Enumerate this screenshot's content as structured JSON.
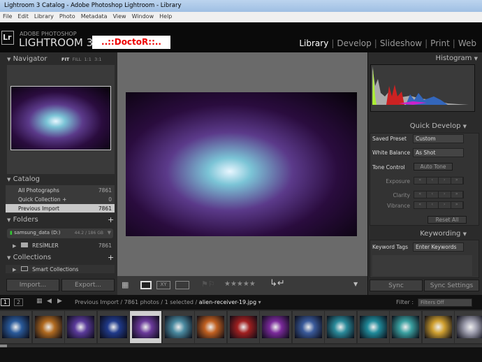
{
  "window": {
    "title": "Lightroom 3 Catalog - Adobe Photoshop Lightroom - Library"
  },
  "menu": [
    "File",
    "Edit",
    "Library",
    "Photo",
    "Metadata",
    "View",
    "Window",
    "Help"
  ],
  "brand": {
    "logo": "Lr",
    "line1": "ADOBE PHOTOSHOP",
    "line2": "LIGHTROOM 3",
    "badge": "..::DoctoR::.."
  },
  "modules": [
    "Library",
    "Develop",
    "Slideshow",
    "Print",
    "Web"
  ],
  "navigator": {
    "title": "Navigator",
    "zoom": [
      "FIT",
      "FILL",
      "1:1",
      "3:1"
    ]
  },
  "catalog": {
    "title": "Catalog",
    "items": [
      {
        "label": "All Photographs",
        "count": "7861"
      },
      {
        "label": "Quick Collection +",
        "count": "0"
      },
      {
        "label": "Previous Import",
        "count": "7861"
      }
    ]
  },
  "folders": {
    "title": "Folders",
    "volume": "samsung_data (D:)",
    "space": "44.2 / 186 GB",
    "folder": "RESİMLER",
    "count": "7861"
  },
  "collections": {
    "title": "Collections",
    "item": "Smart Collections"
  },
  "left_buttons": {
    "import": "Import...",
    "export": "Export..."
  },
  "histogram": {
    "title": "Histogram"
  },
  "quick_develop": {
    "title": "Quick Develop",
    "saved_preset_label": "Saved Preset",
    "saved_preset": "Custom",
    "wb_label": "White Balance",
    "wb": "As Shot",
    "tone_label": "Tone Control",
    "auto_tone": "Auto Tone",
    "exposure": "Exposure",
    "clarity": "Clarity",
    "vibrance": "Vibrance",
    "reset": "Reset All"
  },
  "keywording": {
    "title": "Keywording",
    "tags_label": "Keyword Tags",
    "tags_value": "Enter Keywords"
  },
  "right_buttons": {
    "sync": "Sync",
    "sync_settings": "Sync Settings"
  },
  "toolbar": {
    "stars": "★★★★★"
  },
  "filmstrip": {
    "pages": [
      "1",
      "2"
    ],
    "path": "Previous Import / 7861 photos / 1 selected / ",
    "filename": "alien-receiver-19.jpg",
    "filter_label": "Filter :",
    "filter_value": "Filters Off",
    "thumb_colors": [
      "#2a5a9a",
      "#b06a20",
      "#5a3a9a",
      "#203a8a",
      "#6a3a9a",
      "#4a8aa0",
      "#c06020",
      "#a02020",
      "#7a2a9a",
      "#3a5a9a",
      "#2a8a9a",
      "#208a9a",
      "#3aa0a0",
      "#d0a030",
      "#a0a0b0"
    ]
  }
}
